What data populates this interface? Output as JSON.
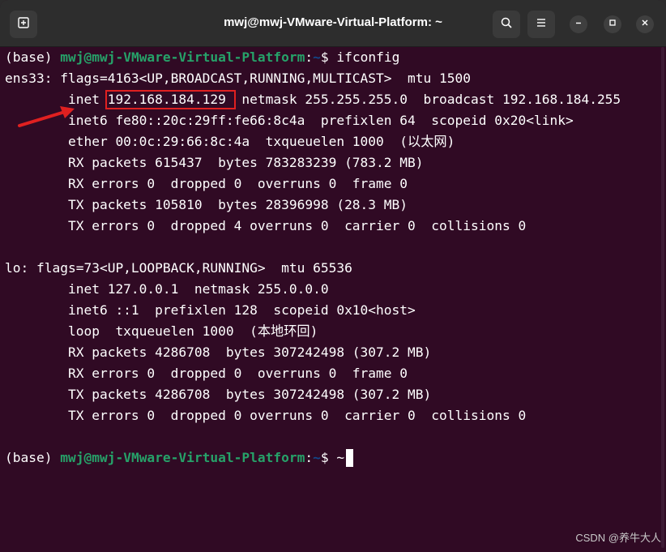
{
  "window": {
    "title": "mwj@mwj-VMware-Virtual-Platform: ~"
  },
  "icons": {
    "new_tab": "new-tab-icon",
    "search": "search-icon",
    "menu": "hamburger-menu-icon",
    "minimize": "minimize-icon",
    "maximize": "maximize-icon",
    "close": "close-icon"
  },
  "colors": {
    "background": "#300a24",
    "prompt_user": "#26a269",
    "prompt_path": "#12488b",
    "highlight_box": "#e02020",
    "arrow": "#e02020"
  },
  "terminal": {
    "prompt1": {
      "prefix": "(base) ",
      "user_host": "mwj@mwj-VMware-Virtual-Platform",
      "sep": ":",
      "path": "~",
      "symbol": "$ ",
      "command": "ifconfig"
    },
    "ens33": {
      "line1": "ens33: flags=4163<UP,BROADCAST,RUNNING,MULTICAST>  mtu 1500",
      "inet_label": "        inet ",
      "inet_ip": "192.168.184.129",
      "inet_rest": "  netmask 255.255.255.0  broadcast 192.168.184.255",
      "inet6": "        inet6 fe80::20c:29ff:fe66:8c4a  prefixlen 64  scopeid 0x20<link>",
      "ether": "        ether 00:0c:29:66:8c:4a  txqueuelen 1000  (以太网)",
      "rx_packets": "        RX packets 615437  bytes 783283239 (783.2 MB)",
      "rx_errors": "        RX errors 0  dropped 0  overruns 0  frame 0",
      "tx_packets": "        TX packets 105810  bytes 28396998 (28.3 MB)",
      "tx_errors": "        TX errors 0  dropped 4 overruns 0  carrier 0  collisions 0"
    },
    "lo": {
      "line1": "lo: flags=73<UP,LOOPBACK,RUNNING>  mtu 65536",
      "inet": "        inet 127.0.0.1  netmask 255.0.0.0",
      "inet6": "        inet6 ::1  prefixlen 128  scopeid 0x10<host>",
      "loop": "        loop  txqueuelen 1000  (本地环回)",
      "rx_packets": "        RX packets 4286708  bytes 307242498 (307.2 MB)",
      "rx_errors": "        RX errors 0  dropped 0  overruns 0  frame 0",
      "tx_packets": "        TX packets 4286708  bytes 307242498 (307.2 MB)",
      "tx_errors": "        TX errors 0  dropped 0 overruns 0  carrier 0  collisions 0"
    },
    "prompt2": {
      "prefix": "(base) ",
      "user_host": "mwj@mwj-VMware-Virtual-Platform",
      "sep": ":",
      "path": "~",
      "symbol": "$ ",
      "input": "~"
    }
  },
  "watermark": "CSDN @养牛大人"
}
